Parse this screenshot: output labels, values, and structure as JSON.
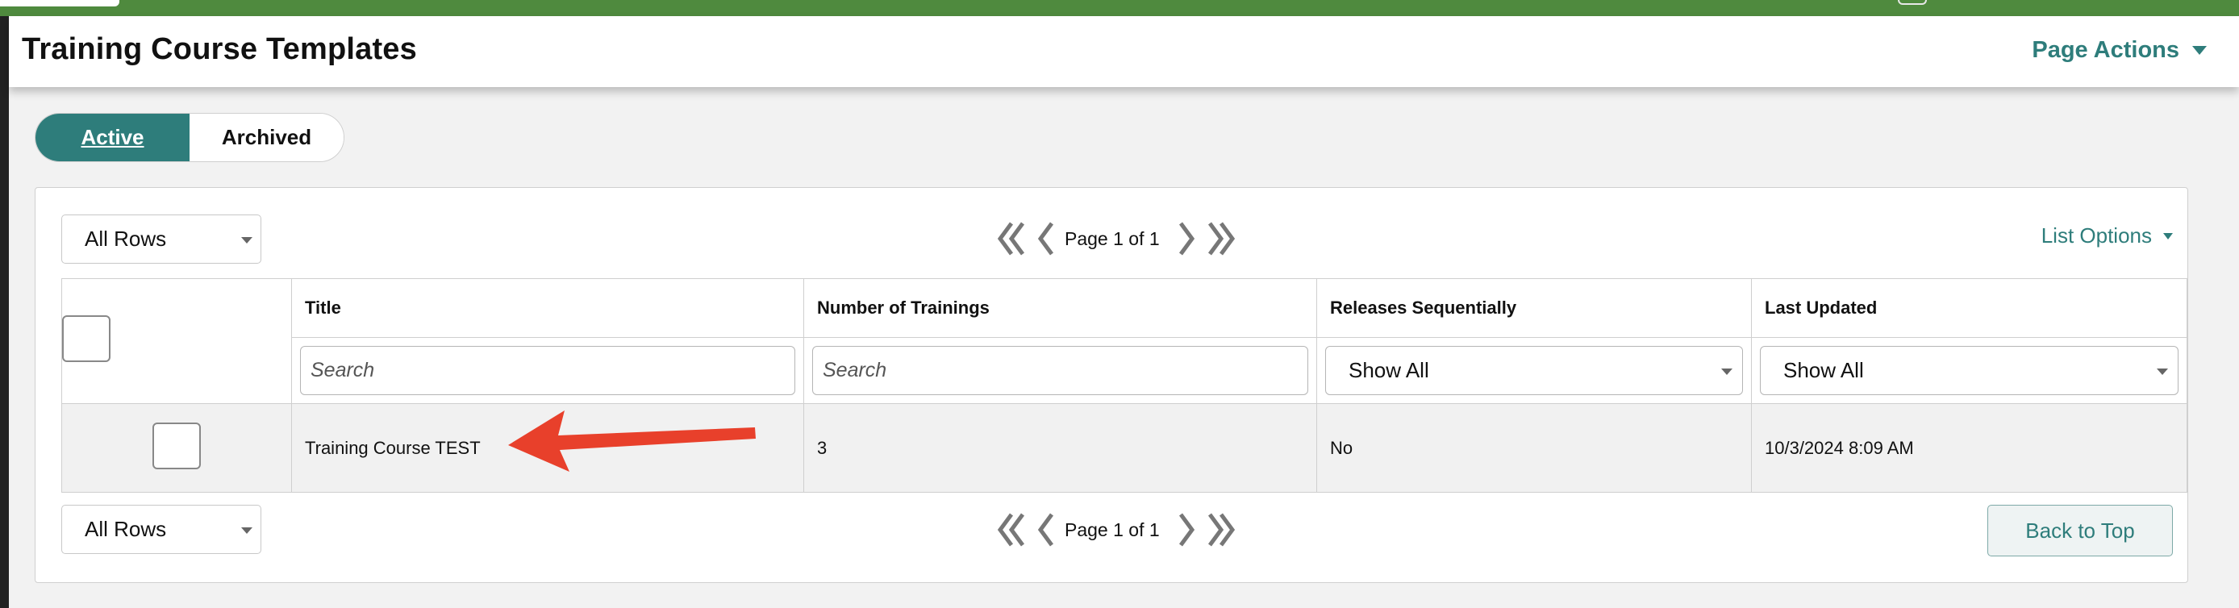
{
  "header": {
    "title": "Training Course Templates",
    "page_actions_label": "Page Actions"
  },
  "status_tabs": [
    {
      "label": "Active",
      "selected": true
    },
    {
      "label": "Archived",
      "selected": false
    }
  ],
  "list": {
    "rows_selector_top": "All Rows",
    "rows_selector_bottom": "All Rows",
    "pagination_text": "Page 1 of 1",
    "list_options_label": "List Options",
    "back_to_top_label": "Back to Top"
  },
  "table": {
    "columns": [
      "Title",
      "Number of Trainings",
      "Releases Sequentially",
      "Last Updated"
    ],
    "filters": {
      "title_placeholder": "Search",
      "trainings_placeholder": "Search",
      "releases_value": "Show All",
      "last_updated_value": "Show All"
    },
    "rows": [
      {
        "title": "Training Course TEST",
        "trainings": "3",
        "releases_sequentially": "No",
        "last_updated": "10/3/2024 8:09 AM"
      }
    ]
  },
  "colors": {
    "brand_green": "#4f8a3e",
    "accent_teal": "#2e7d7b",
    "annotation_red": "#e8402b"
  }
}
